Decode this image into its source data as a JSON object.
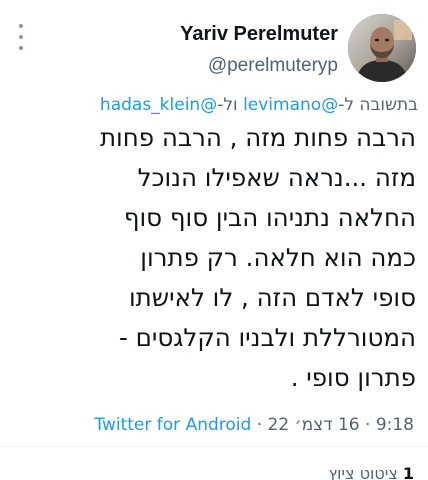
{
  "author": {
    "display_name": "Yariv Perelmuter",
    "handle": "@perelmuteryp",
    "avatar_icon": "user-avatar-photo"
  },
  "reply": {
    "prefix": "בתשובה ל-",
    "mention_1": "@levimano",
    "connector": " ול-",
    "mention_2": "@hadas_klein"
  },
  "tweet": {
    "lines": [
      "הרבה פחות מזה , הרבה פחות",
      "מזה ...נראה שאפילו הנוכל",
      "החלאה   נתניהו הבין סוף סוף",
      "כמה הוא חלאה. רק פתרון",
      "סופי לאדם הזה , לו לאישתו",
      "המטורללת ולבניו הקלגסים -",
      "פתרון סופי ."
    ]
  },
  "meta": {
    "time": "9:18",
    "date": "16 דצמ׳ 22",
    "separator": " · ",
    "source": "Twitter for Android"
  },
  "stats": {
    "count": "1",
    "label": " ציטוט ציוץ"
  },
  "colors": {
    "text": "#0f1419",
    "secondary": "#536471",
    "link": "#1d9bf0"
  }
}
